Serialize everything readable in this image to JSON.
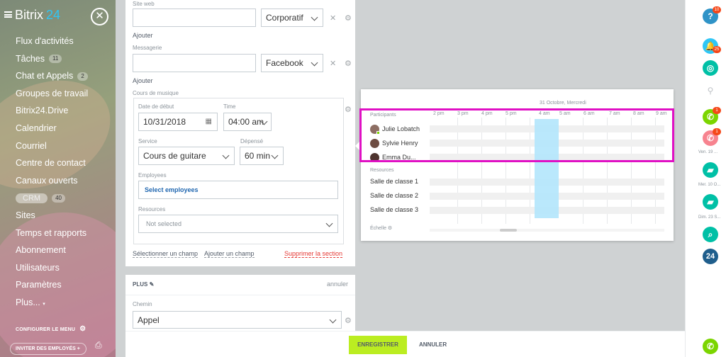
{
  "sidebar": {
    "logo_text": "Bitrix",
    "logo_num": "24",
    "items": [
      {
        "label": "Flux d'activités"
      },
      {
        "label": "Tâches",
        "count": "11"
      },
      {
        "label": "Chat et Appels",
        "count": "2"
      },
      {
        "label": "Groupes de travail"
      },
      {
        "label": "Bitrix24.Drive"
      },
      {
        "label": "Calendrier"
      },
      {
        "label": "Courriel"
      },
      {
        "label": "Centre de contact"
      },
      {
        "label": "Canaux ouverts"
      },
      {
        "label": "CRM",
        "count": "40"
      },
      {
        "label": "Sites"
      },
      {
        "label": "Temps et rapports"
      },
      {
        "label": "Abonnement"
      },
      {
        "label": "Utilisateurs"
      },
      {
        "label": "Paramètres"
      },
      {
        "label": "Plus..."
      }
    ],
    "configure": "CONFIGURER LE MENU",
    "invite": "INVITER DES EMPLOYÉS"
  },
  "form": {
    "site_web_label": "Site web",
    "site_web_type": "Corporatif",
    "add1": "Ajouter",
    "messagerie_label": "Messagerie",
    "messagerie_type": "Facebook",
    "add2": "Ajouter",
    "section_title": "Cours de musique",
    "date_label": "Date de début",
    "date_value": "10/31/2018",
    "time_label": "Time",
    "time_value": "04:00 am",
    "service_label": "Service",
    "service_value": "Cours de guitare",
    "spent_label": "Dépensé",
    "spent_value": "60 min",
    "employees_label": "Employees",
    "employees_link": "Select employees",
    "resources_label": "Resources",
    "resources_value": "Not selected",
    "select_field": "Sélectionner un champ",
    "add_field": "Ajouter un champ",
    "delete_section": "Supprimer la section"
  },
  "plus": {
    "title": "PLUS",
    "cancel": "annuler",
    "path_label": "Chemin",
    "path_value": "Appel"
  },
  "schedule": {
    "date": "31 Octobre, Mercredi",
    "hours": [
      "2 pm",
      "3 pm",
      "4 pm",
      "5 pm",
      "4 am",
      "5 am",
      "6 am",
      "7 am",
      "8 am",
      "9 am"
    ],
    "participants_label": "Participants",
    "participants": [
      "Julie Lobatch",
      "Sylvie Henry",
      "Emma Du..."
    ],
    "resources_label": "Resources",
    "rooms": [
      "Salle de classe 1",
      "Salle de classe 2",
      "Salle de classe 3"
    ],
    "scale_label": "Échelle"
  },
  "rightbar": {
    "help_badge": "10",
    "notif_badge": "25",
    "call1_badge": "1",
    "call2_badge": "1",
    "label1": "Ven. 19 ...",
    "label2": "Mer. 10 O...",
    "label3": "Dim. 23 S...",
    "b24": "24"
  },
  "actions": {
    "save": "ENREGISTRER",
    "cancel": "ANNULER"
  },
  "colors": {
    "accent_green": "#bbed21",
    "highlight": "#e010c4",
    "slot_blue": "#b3e5fc"
  }
}
